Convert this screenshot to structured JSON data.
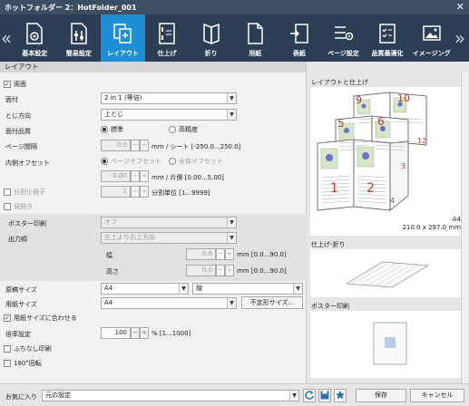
{
  "window": {
    "title": "ホットフォルダー 2：HotFolder_001",
    "close": "✕"
  },
  "toolbar": {
    "left_arrow": "«",
    "right_arrow": "»",
    "items": [
      {
        "label": "基本設定"
      },
      {
        "label": "簡易設定"
      },
      {
        "label": "レイアウト"
      },
      {
        "label": "仕上げ"
      },
      {
        "label": "折り"
      },
      {
        "label": "用紙"
      },
      {
        "label": "表紙"
      },
      {
        "label": "ページ設定"
      },
      {
        "label": "品質最適化"
      },
      {
        "label": "イメージング"
      }
    ]
  },
  "layout": {
    "section_title": "レイアウト",
    "duplex_label": "両面",
    "imposition_label": "面付",
    "imposition_value": "2 in 1 (等倍)",
    "binding_label": "とじ方向",
    "binding_value": "上とじ",
    "quality_label": "面付品質",
    "quality_standard": "標準",
    "quality_high": "高精度",
    "page_gap_label": "ページ間隔",
    "page_gap_value": "0.0",
    "page_gap_unit": "mm / シート [-250.0...250.0]",
    "inner_offset_label": "内側オフセット",
    "page_offset": "ページオフセット",
    "all_offset": "全体オフセット",
    "offset_value": "0.00",
    "offset_unit": "mm / 片側 [0.00...5.00]",
    "split_label": "分割小冊子",
    "split_value": "1",
    "split_unit": "分割単位 [1...9999]",
    "spread_label": "見開き",
    "poster_label": "ポスター印刷",
    "poster_value": "オフ",
    "output_order_label": "出力順",
    "output_order_value": "左上より右上方向",
    "width_label": "幅",
    "width_value": "0.0",
    "width_unit": "mm [0.0...90.0]",
    "height_label": "高さ",
    "height_value": "0.0",
    "height_unit": "mm [0.0...90.0]",
    "orig_size_label": "原稿サイズ",
    "orig_size_value": "A4",
    "orig_orient_value": "縦",
    "paper_size_label": "用紙サイズ",
    "paper_size_value": "A4",
    "custom_size_button": "不定形サイズ...",
    "fit_paper_label": "用紙サイズに合わせる",
    "scale_label": "倍率設定",
    "scale_value": "100",
    "scale_unit": "% [1...1000]",
    "borderless_label": "ふちなし印刷",
    "rotate_label": "180°回転",
    "minus": "−",
    "plus": "+",
    "dropdown_arrow": "▼"
  },
  "preview": {
    "layout_title": "レイアウトと仕上げ",
    "paper_name": "A4",
    "paper_dims": "210.0 x 297.0 mm",
    "fold_title": "仕上げ-折り",
    "poster_title": "ポスター印刷",
    "page_numbers": [
      "1",
      "2",
      "3",
      "4",
      "5",
      "6",
      "9",
      "10",
      "12"
    ]
  },
  "footer": {
    "favorites_label": "お気に入り",
    "favorites_value": "元の設定",
    "ok_label": "保存",
    "cancel_label": "キャンセル"
  },
  "colors": {
    "title_bg": "#3d4e63",
    "toolbar_bg": "#2c3e55",
    "active_tab": "#1e8fd6",
    "page_number_red": "#c0392b"
  }
}
